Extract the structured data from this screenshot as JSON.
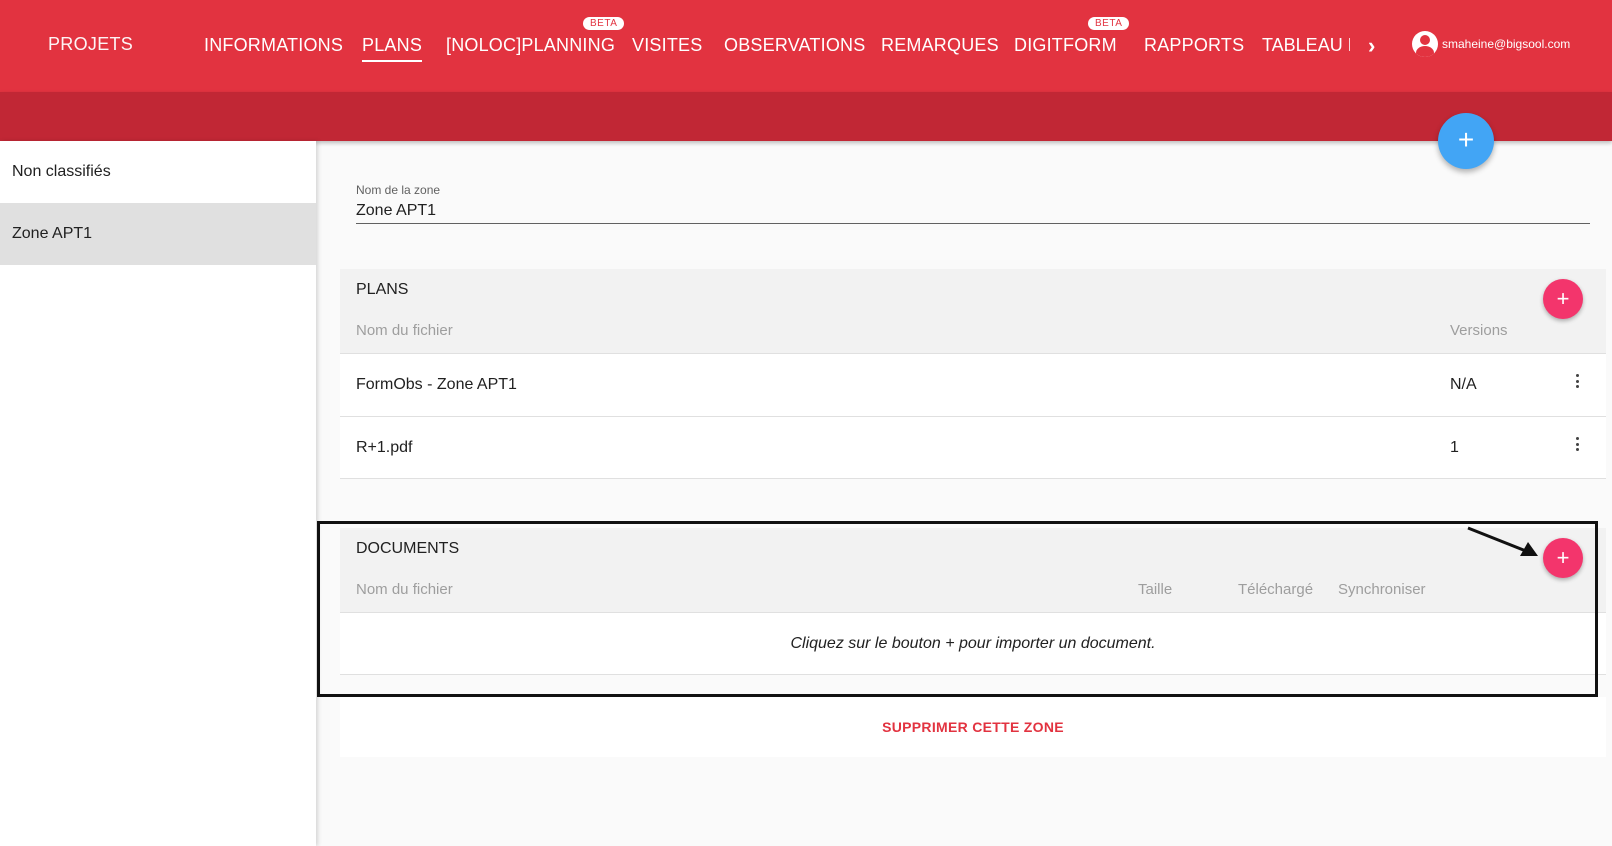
{
  "nav": {
    "brand": "PROJETS",
    "items": [
      {
        "label": "INFORMATIONS"
      },
      {
        "label": "PLANS"
      },
      {
        "label": "[NOLOC]PLANNING",
        "badge": "BETA"
      },
      {
        "label": "VISITES"
      },
      {
        "label": "OBSERVATIONS"
      },
      {
        "label": "REMARQUES"
      },
      {
        "label": "DIGITFORM",
        "badge": "BETA"
      },
      {
        "label": "RAPPORTS"
      },
      {
        "label": "TABLEAU DE BORD"
      }
    ],
    "more_icon": "chevron-right-icon",
    "user_email": "smaheine@bigsool.com"
  },
  "sidebar": {
    "items": [
      {
        "label": "Non classifiés"
      },
      {
        "label": "Zone APT1"
      }
    ]
  },
  "zone": {
    "label": "Nom de la zone",
    "value": "Zone APT1"
  },
  "plans": {
    "title": "PLANS",
    "columns": {
      "name": "Nom du fichier",
      "versions": "Versions"
    },
    "rows": [
      {
        "name": "FormObs - Zone APT1",
        "versions": "N/A"
      },
      {
        "name": "R+1.pdf",
        "versions": "1"
      }
    ]
  },
  "documents": {
    "title": "DOCUMENTS",
    "columns": {
      "name": "Nom du fichier",
      "size": "Taille",
      "downloaded": "Téléchargé",
      "sync": "Synchroniser"
    },
    "empty_message": "Cliquez sur le bouton + pour importer un document."
  },
  "actions": {
    "add_symbol": "+",
    "delete_zone": "SUPPRIMER CETTE ZONE"
  },
  "colors": {
    "primary": "#e23340",
    "primary_dark": "#c12735",
    "fab_blue": "#42a5f5",
    "fab_pink": "#f3356c"
  }
}
